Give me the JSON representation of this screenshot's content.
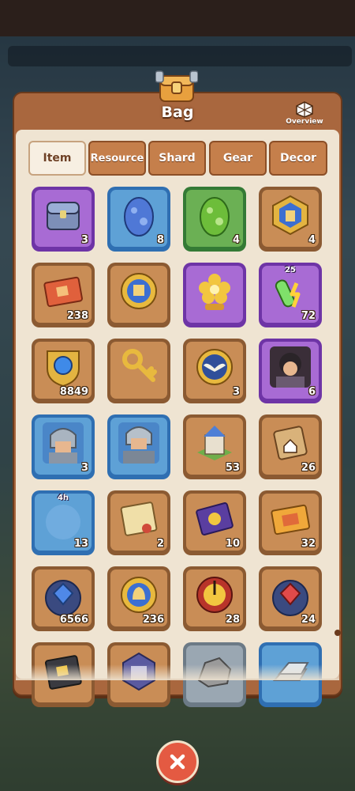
{
  "window": {
    "title": "Bag",
    "overview_label": "Overview"
  },
  "tabs": [
    {
      "label": "Item",
      "active": true
    },
    {
      "label": "Resource",
      "active": false
    },
    {
      "label": "Shard",
      "active": false
    },
    {
      "label": "Gear",
      "active": false
    },
    {
      "label": "Decor",
      "active": false
    }
  ],
  "items": [
    {
      "name": "treasure-chest-icon",
      "rarity": "purple",
      "count": "3"
    },
    {
      "name": "blue-egg-icon",
      "rarity": "blue",
      "count": "8"
    },
    {
      "name": "green-egg-icon",
      "rarity": "green",
      "count": "4"
    },
    {
      "name": "castle-badge-icon",
      "rarity": "brown",
      "count": "4"
    },
    {
      "name": "castle-ticket-icon",
      "rarity": "brown",
      "count": "238"
    },
    {
      "name": "castle-coin-icon",
      "rarity": "brown",
      "count": ""
    },
    {
      "name": "golden-flower-icon",
      "rarity": "purple",
      "count": ""
    },
    {
      "name": "potion-icon",
      "rarity": "purple",
      "count": "72",
      "top": "25"
    },
    {
      "name": "blue-gem-shield-icon",
      "rarity": "brown",
      "count": "8849"
    },
    {
      "name": "golden-key-icon",
      "rarity": "brown",
      "count": ""
    },
    {
      "name": "wings-medal-icon",
      "rarity": "brown",
      "count": "3"
    },
    {
      "name": "dark-hero-portrait-icon",
      "rarity": "purple",
      "count": "6"
    },
    {
      "name": "knight-hero-portrait-icon",
      "rarity": "blue",
      "count": "3"
    },
    {
      "name": "armored-hero-portrait-icon",
      "rarity": "blue",
      "count": ""
    },
    {
      "name": "castle-building-icon",
      "rarity": "brown",
      "count": "53"
    },
    {
      "name": "home-scroll-icon",
      "rarity": "brown",
      "count": "26"
    },
    {
      "name": "timed-bubble-icon",
      "rarity": "blue",
      "count": "13",
      "top": "4h"
    },
    {
      "name": "map-scroll-icon",
      "rarity": "brown",
      "count": "2"
    },
    {
      "name": "orb-ticket-icon",
      "rarity": "brown",
      "count": "10"
    },
    {
      "name": "golden-ticket-icon",
      "rarity": "brown",
      "count": "32"
    },
    {
      "name": "blue-gem-coin-icon",
      "rarity": "brown",
      "count": "6566"
    },
    {
      "name": "bell-coin-icon",
      "rarity": "brown",
      "count": "236"
    },
    {
      "name": "red-wheel-icon",
      "rarity": "brown",
      "count": "28"
    },
    {
      "name": "red-gem-coin-icon",
      "rarity": "brown",
      "count": "24"
    },
    {
      "name": "castle-card-icon",
      "rarity": "brown",
      "count": ""
    },
    {
      "name": "dice-icon",
      "rarity": "brown",
      "count": ""
    },
    {
      "name": "stone-icon",
      "rarity": "grey",
      "count": ""
    },
    {
      "name": "iron-ingot-icon",
      "rarity": "blue",
      "count": ""
    }
  ],
  "colors": {
    "panel": "#a9673e",
    "inner": "#efe4d2",
    "close": "#e45a42"
  }
}
